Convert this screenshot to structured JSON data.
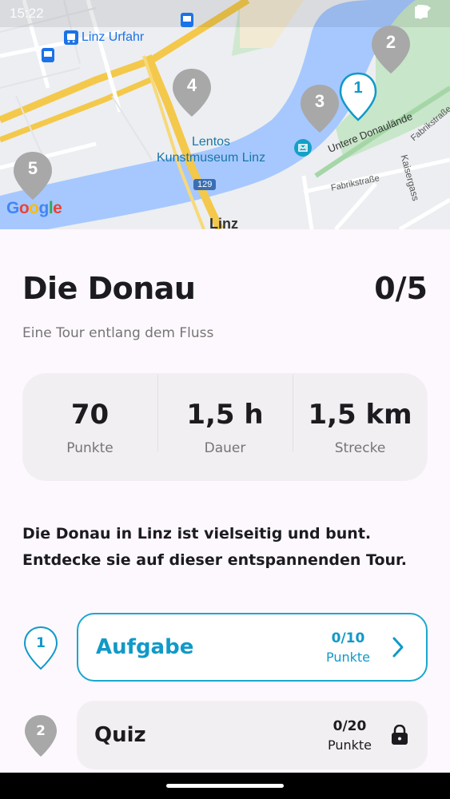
{
  "status_bar": {
    "time": "15:22"
  },
  "map": {
    "labels": {
      "urfahr": "Linz Urfahr",
      "lentos_line1": "Lentos",
      "lentos_line2": "Kunstmuseum Linz",
      "street_untere": "Untere Donaulände",
      "street_fabrik1": "Fabrikstraße",
      "street_fabrik2": "Fabrikstraße",
      "street_kaiser": "Kaisergass",
      "city": "Linz",
      "road_number": "129"
    },
    "google_logo": [
      "G",
      "o",
      "o",
      "g",
      "l",
      "e"
    ],
    "markers": [
      "1",
      "2",
      "3",
      "4",
      "5"
    ],
    "colors": {
      "water": "#a6c8ff",
      "active_marker": "#1199c8",
      "inactive_marker": "#9e9e9e",
      "park": "#c8e6c9"
    }
  },
  "tour": {
    "title": "Die Donau",
    "progress": "0/5",
    "subtitle": "Eine Tour entlang dem Fluss",
    "stats": [
      {
        "value": "70",
        "label": "Punkte"
      },
      {
        "value": "1,5 h",
        "label": "Dauer"
      },
      {
        "value": "1,5 km",
        "label": "Strecke"
      }
    ],
    "description_line1": "Die Donau in Linz ist vielseitig und bunt.",
    "description_line2": "Entdecke sie auf dieser entspannenden Tour.",
    "steps": [
      {
        "number": "1",
        "name": "Aufgabe",
        "score": "0/10",
        "unit": "Punkte",
        "state": "active",
        "icon": "chevron-right-icon"
      },
      {
        "number": "2",
        "name": "Quiz",
        "score": "0/20",
        "unit": "Punkte",
        "state": "locked",
        "icon": "lock-icon"
      }
    ]
  },
  "accent_color": "#1aa7cf"
}
